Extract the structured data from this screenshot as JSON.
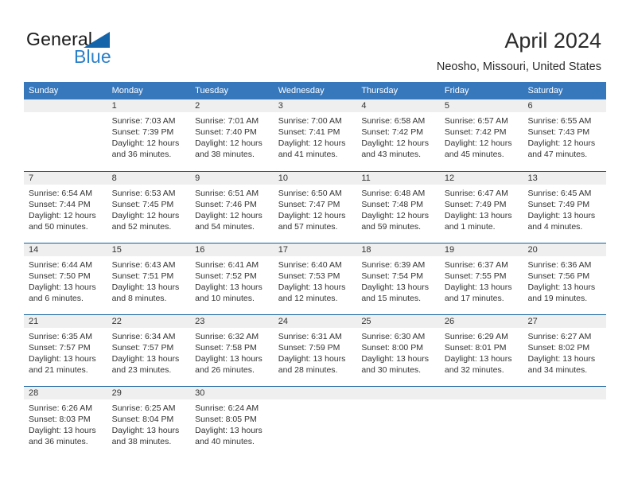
{
  "brand": {
    "word_one": "General",
    "word_two": "Blue",
    "triangle_icon": "triangle-icon"
  },
  "header": {
    "title": "April 2024",
    "location": "Neosho, Missouri, United States"
  },
  "calendar": {
    "weekdays": [
      "Sunday",
      "Monday",
      "Tuesday",
      "Wednesday",
      "Thursday",
      "Friday",
      "Saturday"
    ],
    "accent_color": "#3778bd",
    "row_line_color": "#14619e",
    "day_band_color": "#efefef",
    "weeks": [
      [
        {
          "day": "",
          "sunrise": "",
          "sunset": "",
          "daylight_line1": "",
          "daylight_line2": "",
          "empty": true
        },
        {
          "day": "1",
          "sunrise": "Sunrise: 7:03 AM",
          "sunset": "Sunset: 7:39 PM",
          "daylight_line1": "Daylight: 12 hours",
          "daylight_line2": "and 36 minutes.",
          "empty": false
        },
        {
          "day": "2",
          "sunrise": "Sunrise: 7:01 AM",
          "sunset": "Sunset: 7:40 PM",
          "daylight_line1": "Daylight: 12 hours",
          "daylight_line2": "and 38 minutes.",
          "empty": false
        },
        {
          "day": "3",
          "sunrise": "Sunrise: 7:00 AM",
          "sunset": "Sunset: 7:41 PM",
          "daylight_line1": "Daylight: 12 hours",
          "daylight_line2": "and 41 minutes.",
          "empty": false
        },
        {
          "day": "4",
          "sunrise": "Sunrise: 6:58 AM",
          "sunset": "Sunset: 7:42 PM",
          "daylight_line1": "Daylight: 12 hours",
          "daylight_line2": "and 43 minutes.",
          "empty": false
        },
        {
          "day": "5",
          "sunrise": "Sunrise: 6:57 AM",
          "sunset": "Sunset: 7:42 PM",
          "daylight_line1": "Daylight: 12 hours",
          "daylight_line2": "and 45 minutes.",
          "empty": false
        },
        {
          "day": "6",
          "sunrise": "Sunrise: 6:55 AM",
          "sunset": "Sunset: 7:43 PM",
          "daylight_line1": "Daylight: 12 hours",
          "daylight_line2": "and 47 minutes.",
          "empty": false
        }
      ],
      [
        {
          "day": "7",
          "sunrise": "Sunrise: 6:54 AM",
          "sunset": "Sunset: 7:44 PM",
          "daylight_line1": "Daylight: 12 hours",
          "daylight_line2": "and 50 minutes.",
          "empty": false
        },
        {
          "day": "8",
          "sunrise": "Sunrise: 6:53 AM",
          "sunset": "Sunset: 7:45 PM",
          "daylight_line1": "Daylight: 12 hours",
          "daylight_line2": "and 52 minutes.",
          "empty": false
        },
        {
          "day": "9",
          "sunrise": "Sunrise: 6:51 AM",
          "sunset": "Sunset: 7:46 PM",
          "daylight_line1": "Daylight: 12 hours",
          "daylight_line2": "and 54 minutes.",
          "empty": false
        },
        {
          "day": "10",
          "sunrise": "Sunrise: 6:50 AM",
          "sunset": "Sunset: 7:47 PM",
          "daylight_line1": "Daylight: 12 hours",
          "daylight_line2": "and 57 minutes.",
          "empty": false
        },
        {
          "day": "11",
          "sunrise": "Sunrise: 6:48 AM",
          "sunset": "Sunset: 7:48 PM",
          "daylight_line1": "Daylight: 12 hours",
          "daylight_line2": "and 59 minutes.",
          "empty": false
        },
        {
          "day": "12",
          "sunrise": "Sunrise: 6:47 AM",
          "sunset": "Sunset: 7:49 PM",
          "daylight_line1": "Daylight: 13 hours",
          "daylight_line2": "and 1 minute.",
          "empty": false
        },
        {
          "day": "13",
          "sunrise": "Sunrise: 6:45 AM",
          "sunset": "Sunset: 7:49 PM",
          "daylight_line1": "Daylight: 13 hours",
          "daylight_line2": "and 4 minutes.",
          "empty": false
        }
      ],
      [
        {
          "day": "14",
          "sunrise": "Sunrise: 6:44 AM",
          "sunset": "Sunset: 7:50 PM",
          "daylight_line1": "Daylight: 13 hours",
          "daylight_line2": "and 6 minutes.",
          "empty": false
        },
        {
          "day": "15",
          "sunrise": "Sunrise: 6:43 AM",
          "sunset": "Sunset: 7:51 PM",
          "daylight_line1": "Daylight: 13 hours",
          "daylight_line2": "and 8 minutes.",
          "empty": false
        },
        {
          "day": "16",
          "sunrise": "Sunrise: 6:41 AM",
          "sunset": "Sunset: 7:52 PM",
          "daylight_line1": "Daylight: 13 hours",
          "daylight_line2": "and 10 minutes.",
          "empty": false
        },
        {
          "day": "17",
          "sunrise": "Sunrise: 6:40 AM",
          "sunset": "Sunset: 7:53 PM",
          "daylight_line1": "Daylight: 13 hours",
          "daylight_line2": "and 12 minutes.",
          "empty": false
        },
        {
          "day": "18",
          "sunrise": "Sunrise: 6:39 AM",
          "sunset": "Sunset: 7:54 PM",
          "daylight_line1": "Daylight: 13 hours",
          "daylight_line2": "and 15 minutes.",
          "empty": false
        },
        {
          "day": "19",
          "sunrise": "Sunrise: 6:37 AM",
          "sunset": "Sunset: 7:55 PM",
          "daylight_line1": "Daylight: 13 hours",
          "daylight_line2": "and 17 minutes.",
          "empty": false
        },
        {
          "day": "20",
          "sunrise": "Sunrise: 6:36 AM",
          "sunset": "Sunset: 7:56 PM",
          "daylight_line1": "Daylight: 13 hours",
          "daylight_line2": "and 19 minutes.",
          "empty": false
        }
      ],
      [
        {
          "day": "21",
          "sunrise": "Sunrise: 6:35 AM",
          "sunset": "Sunset: 7:57 PM",
          "daylight_line1": "Daylight: 13 hours",
          "daylight_line2": "and 21 minutes.",
          "empty": false
        },
        {
          "day": "22",
          "sunrise": "Sunrise: 6:34 AM",
          "sunset": "Sunset: 7:57 PM",
          "daylight_line1": "Daylight: 13 hours",
          "daylight_line2": "and 23 minutes.",
          "empty": false
        },
        {
          "day": "23",
          "sunrise": "Sunrise: 6:32 AM",
          "sunset": "Sunset: 7:58 PM",
          "daylight_line1": "Daylight: 13 hours",
          "daylight_line2": "and 26 minutes.",
          "empty": false
        },
        {
          "day": "24",
          "sunrise": "Sunrise: 6:31 AM",
          "sunset": "Sunset: 7:59 PM",
          "daylight_line1": "Daylight: 13 hours",
          "daylight_line2": "and 28 minutes.",
          "empty": false
        },
        {
          "day": "25",
          "sunrise": "Sunrise: 6:30 AM",
          "sunset": "Sunset: 8:00 PM",
          "daylight_line1": "Daylight: 13 hours",
          "daylight_line2": "and 30 minutes.",
          "empty": false
        },
        {
          "day": "26",
          "sunrise": "Sunrise: 6:29 AM",
          "sunset": "Sunset: 8:01 PM",
          "daylight_line1": "Daylight: 13 hours",
          "daylight_line2": "and 32 minutes.",
          "empty": false
        },
        {
          "day": "27",
          "sunrise": "Sunrise: 6:27 AM",
          "sunset": "Sunset: 8:02 PM",
          "daylight_line1": "Daylight: 13 hours",
          "daylight_line2": "and 34 minutes.",
          "empty": false
        }
      ],
      [
        {
          "day": "28",
          "sunrise": "Sunrise: 6:26 AM",
          "sunset": "Sunset: 8:03 PM",
          "daylight_line1": "Daylight: 13 hours",
          "daylight_line2": "and 36 minutes.",
          "empty": false
        },
        {
          "day": "29",
          "sunrise": "Sunrise: 6:25 AM",
          "sunset": "Sunset: 8:04 PM",
          "daylight_line1": "Daylight: 13 hours",
          "daylight_line2": "and 38 minutes.",
          "empty": false
        },
        {
          "day": "30",
          "sunrise": "Sunrise: 6:24 AM",
          "sunset": "Sunset: 8:05 PM",
          "daylight_line1": "Daylight: 13 hours",
          "daylight_line2": "and 40 minutes.",
          "empty": false
        },
        {
          "day": "",
          "sunrise": "",
          "sunset": "",
          "daylight_line1": "",
          "daylight_line2": "",
          "empty": true
        },
        {
          "day": "",
          "sunrise": "",
          "sunset": "",
          "daylight_line1": "",
          "daylight_line2": "",
          "empty": true
        },
        {
          "day": "",
          "sunrise": "",
          "sunset": "",
          "daylight_line1": "",
          "daylight_line2": "",
          "empty": true
        },
        {
          "day": "",
          "sunrise": "",
          "sunset": "",
          "daylight_line1": "",
          "daylight_line2": "",
          "empty": true
        }
      ]
    ]
  }
}
